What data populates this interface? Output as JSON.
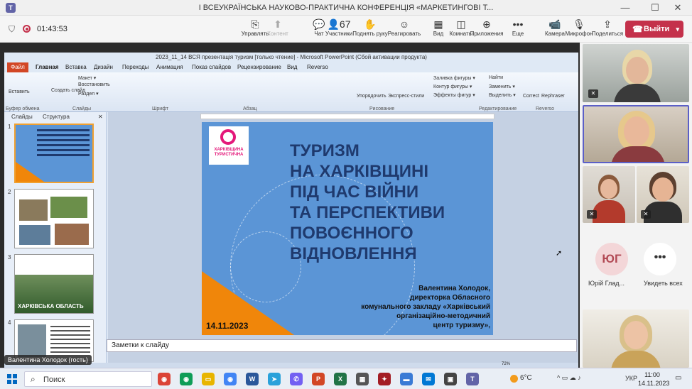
{
  "window": {
    "title": "I ВСЕУКРАЇНСЬКА НАУКОВО-ПРАКТИЧНА КОНФЕРЕНЦІЯ «МАРКЕТИНГОВІ Т...",
    "app_icon": "T",
    "min": "—",
    "max": "☐",
    "close": "✕"
  },
  "meeting": {
    "timer": "01:43:53"
  },
  "toolbar": [
    {
      "icon": "manage-icon",
      "glyph": "⎘",
      "label": "Управлять",
      "disabled": false
    },
    {
      "icon": "content-icon",
      "glyph": "⬆",
      "label": "Контент",
      "disabled": true
    },
    {
      "icon": "chat-icon",
      "glyph": "💬",
      "label": "Чат",
      "disabled": false
    },
    {
      "icon": "people-icon",
      "glyph": "👤67",
      "label": "Участники",
      "disabled": false
    },
    {
      "icon": "raise-hand-icon",
      "glyph": "✋",
      "label": "Поднять руку",
      "disabled": false
    },
    {
      "icon": "react-icon",
      "glyph": "☺",
      "label": "Реагировать",
      "disabled": false
    },
    {
      "icon": "view-icon",
      "glyph": "▦",
      "label": "Вид",
      "disabled": false
    },
    {
      "icon": "rooms-icon",
      "glyph": "◫",
      "label": "Комнаты",
      "disabled": false
    },
    {
      "icon": "apps-icon",
      "glyph": "⊕",
      "label": "Приложения",
      "disabled": false
    },
    {
      "icon": "more-icon",
      "glyph": "•••",
      "label": "Еще",
      "disabled": false
    },
    {
      "icon": "camera-icon",
      "glyph": "📹",
      "label": "Камера",
      "disabled": false
    },
    {
      "icon": "mic-icon",
      "glyph": "🎙",
      "label": "Микрофон",
      "disabled": false
    },
    {
      "icon": "share-icon",
      "glyph": "⇪",
      "label": "Поделиться",
      "disabled": false
    }
  ],
  "leave": {
    "label": "Выйти",
    "glyph": "☎",
    "chevron": "▾"
  },
  "ppt": {
    "title": "2023_11_14 ВСЯ презентація туризм [только чтение] - Microsoft PowerPoint (Сбой активации продукта)",
    "file_tab": "Файл",
    "menu": [
      "Главная",
      "Вставка",
      "Дизайн",
      "Переходы",
      "Анимация",
      "Показ слайдов",
      "Рецензирование",
      "Вид",
      "Reverso"
    ],
    "ribbon_items": [
      "Вставить",
      "Создать слайд",
      "Макет ▾",
      "Восстановить",
      "Раздел ▾",
      "Упорядочить",
      "Экспресс-стили",
      "Заливка фигуры ▾",
      "Контур фигуры ▾",
      "Эффекты фигур ▾",
      "Найти",
      "Заменить ▾",
      "Выделить ▾",
      "Correct",
      "Rephraser"
    ],
    "ribbon_groups": [
      "Буфер обмена",
      "Слайды",
      "Шрифт",
      "Абзац",
      "Рисование",
      "Редактирование",
      "Reverso"
    ],
    "panel_tabs": [
      "Слайды",
      "Структура"
    ],
    "thumb_numbers": [
      "1",
      "2",
      "3",
      "4"
    ],
    "thumb3_caption": "ХАРКІВСЬКА ОБЛАСТЬ",
    "notes_placeholder": "Заметки к слайду",
    "zoom": "72%"
  },
  "slide": {
    "logo_text": "ХАРКІВЩИНА ТУРИСТИЧНА",
    "title": "ТУРИЗМ\nНА ХАРКІВЩИНІ\nПІД ЧАС ВІЙНИ\nТА ПЕРСПЕКТИВИ\nПОВОЄННОГО\nВІДНОВЛЕННЯ",
    "author": "Валентина  Холодок,\nдиректорка Обласного\nкомунального закладу «Харківський\nорганізаційно-методичний\nцентр туризму»,",
    "date": "14.11.2023"
  },
  "presenter_name": "Валентина Холодок (гость)",
  "participants": {
    "yg_initials": "ЮГ",
    "yg_name": "Юрій Глад...",
    "see_all": "Увидеть всех",
    "see_all_glyph": "•••"
  },
  "colors": {
    "leave": "#c4314b",
    "slide_blue": "#5b95d6",
    "slide_orange": "#f0860a",
    "teams_accent": "#6264a7",
    "active_speaker_border": "#5b5fc7"
  },
  "taskbar": {
    "search_label": "Поиск",
    "apps": [
      {
        "icon": "chrome-icon",
        "glyph": "◉",
        "color": "#db4437"
      },
      {
        "icon": "chrome-icon-2",
        "glyph": "◉",
        "color": "#0f9d58"
      },
      {
        "icon": "explorer-icon",
        "glyph": "▭",
        "color": "#e8b500"
      },
      {
        "icon": "chrome-icon-3",
        "glyph": "◉",
        "color": "#4285f4"
      },
      {
        "icon": "word-icon",
        "glyph": "W",
        "color": "#2b579a"
      },
      {
        "icon": "telegram-icon",
        "glyph": "➤",
        "color": "#2aa1da"
      },
      {
        "icon": "viber-icon",
        "glyph": "✆",
        "color": "#7360f2"
      },
      {
        "icon": "powerpoint-icon",
        "glyph": "P",
        "color": "#d24726"
      },
      {
        "icon": "excel-icon",
        "glyph": "X",
        "color": "#217346"
      },
      {
        "icon": "calculator-icon",
        "glyph": "▦",
        "color": "#555555"
      },
      {
        "icon": "app-icon-red",
        "glyph": "✦",
        "color": "#a31d24"
      },
      {
        "icon": "app-icon-flag",
        "glyph": "▬",
        "color": "#3a7bd5"
      },
      {
        "icon": "mail-icon",
        "glyph": "✉",
        "color": "#0078d4"
      },
      {
        "icon": "store-icon",
        "glyph": "▣",
        "color": "#444444"
      },
      {
        "icon": "teams-icon",
        "glyph": "T",
        "color": "#6264a7"
      }
    ],
    "weather": "6°C",
    "lang": "УКР",
    "time": "11:00",
    "date": "14.11.2023",
    "tray": "^  ▭  ☁  ♪"
  }
}
